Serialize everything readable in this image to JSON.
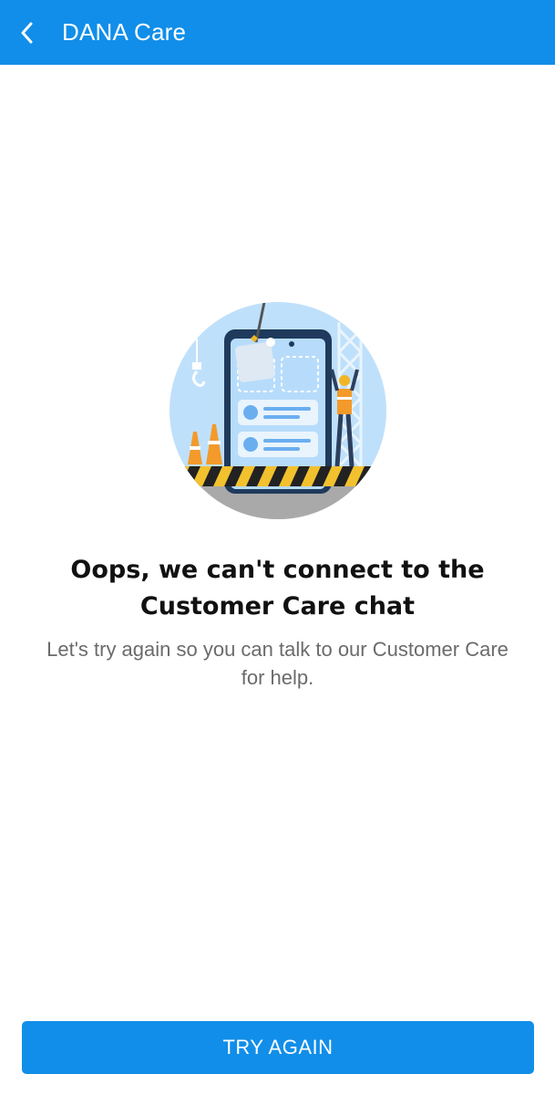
{
  "appbar": {
    "title": "DANA Care",
    "back_icon": "chevron-left-icon",
    "background_color": "#118ee9"
  },
  "illustration": {
    "name": "under-construction-illustration"
  },
  "error": {
    "title": "Oops, we can't connect to the Customer Care chat",
    "message": "Let's try again so you can talk to our Customer Care for help."
  },
  "actions": {
    "try_again_label": "TRY AGAIN",
    "button_color": "#118ee9"
  }
}
